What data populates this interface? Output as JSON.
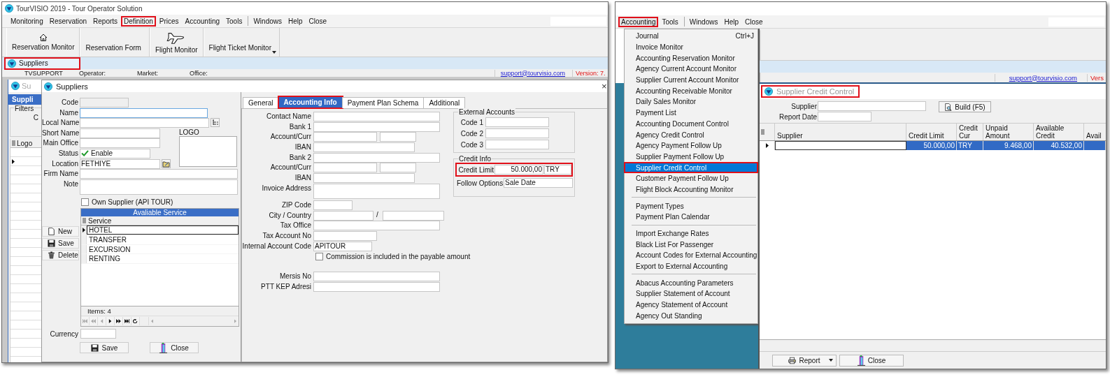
{
  "left_screen": {
    "title": "TourVISIO 2019 - Tour Operator Solution",
    "menu": [
      [
        {
          "label": "Monitoring",
          "highlighted": false
        },
        {
          "label": "Reservation",
          "highlighted": false
        },
        {
          "label": "Reports",
          "highlighted": false
        },
        {
          "label": "Definition",
          "highlighted": true
        },
        {
          "label": "Prices",
          "highlighted": false
        },
        {
          "label": "Accounting",
          "highlighted": false
        },
        {
          "label": "Tools",
          "highlighted": false
        }
      ],
      [
        {
          "label": "Windows",
          "highlighted": false
        },
        {
          "label": "Help",
          "highlighted": false
        },
        {
          "label": "Close",
          "highlighted": false
        }
      ]
    ],
    "toolbar": [
      {
        "label": "Reservation Monitor",
        "kind": "house",
        "dropdown": false
      },
      {
        "label": "Reservation Form",
        "kind": "plain",
        "dropdown": false
      },
      {
        "label": "Flight Monitor",
        "kind": "plane",
        "dropdown": false
      },
      {
        "label": "Flight Ticket Monitor",
        "kind": "plain",
        "dropdown": true
      }
    ],
    "open_tabs": [
      {
        "label": "Suppliers",
        "selected": true,
        "highlighted": true
      }
    ],
    "status_bar": {
      "user": "TVSUPPORT",
      "operator": "Operator:",
      "market": "Market:",
      "office": "Office:",
      "email": "support@tourvisio.com",
      "version": "Version: 7."
    },
    "background_window": {
      "title": "Su",
      "header": "Suppli",
      "filters": "Filters",
      "filter_label": "C",
      "column": "Logo"
    },
    "dialog": {
      "title": "Suppliers",
      "close": "×",
      "fields": [
        {
          "label": "Code",
          "kind": "code",
          "focused": false
        },
        {
          "label": "Name",
          "kind": "name",
          "focused": true
        },
        {
          "label": "Local Name",
          "kind": "lookup",
          "focused": false
        },
        {
          "label": "Short Name",
          "kind": "short",
          "focused": false
        },
        {
          "label": "Main Office",
          "kind": "short",
          "focused": false
        },
        {
          "label": "Status",
          "kind": "status",
          "value": "Enable",
          "focused": false
        },
        {
          "label": "Location",
          "kind": "location",
          "value": "FETHIYE",
          "focused": false
        },
        {
          "label": "Firm Name",
          "kind": "wide",
          "focused": false
        },
        {
          "label": "Note",
          "kind": "note",
          "focused": false
        }
      ],
      "logo_label": "LOGO",
      "own_supplier": {
        "label": "Own Supplier (API TOUR)",
        "checked": false
      },
      "side_buttons": [
        {
          "label": "New",
          "kind": "new"
        },
        {
          "label": "Save",
          "kind": "save"
        },
        {
          "label": "Delete",
          "kind": "delete"
        }
      ],
      "services": {
        "title": "Avaliable Service",
        "column": "Service",
        "rows": [
          {
            "name": "HOTEL",
            "selected": true
          },
          {
            "name": "TRANSFER",
            "selected": false
          },
          {
            "name": "EXCURSION",
            "selected": false
          },
          {
            "name": "RENTING",
            "selected": false
          }
        ],
        "footer": "Items: 4"
      },
      "currency_label": "Currency",
      "buttons": [
        {
          "label": "Save",
          "kind": "save"
        },
        {
          "label": "Close",
          "kind": "close"
        }
      ],
      "tabs": [
        {
          "label": "General",
          "selected": false,
          "highlighted": false
        },
        {
          "label": "Accounting Info",
          "selected": true,
          "highlighted": true
        },
        {
          "label": "Payment Plan Schema",
          "selected": false,
          "highlighted": false
        },
        {
          "label": "Additional",
          "selected": false,
          "highlighted": false
        }
      ],
      "accounting_fields": [
        {
          "label": "Contact Name",
          "kind": "wide"
        },
        {
          "label": "Bank 1",
          "kind": "wide"
        },
        {
          "label": "Account/Curr",
          "kind": "pair"
        },
        {
          "label": "IBAN",
          "kind": "medium"
        },
        {
          "label": "Bank 2",
          "kind": "wide"
        },
        {
          "label": "Account/Curr",
          "kind": "pair"
        },
        {
          "label": "IBAN",
          "kind": "medium"
        },
        {
          "label": "Invoice Address",
          "kind": "address"
        },
        {
          "label": "ZIP Code",
          "kind": "zip"
        },
        {
          "label": "City / Country",
          "kind": "city",
          "separator": "/"
        },
        {
          "label": "Tax Office",
          "kind": "wide"
        },
        {
          "label": "Tax Account No",
          "kind": "account_no"
        },
        {
          "label": "Internal Account Code",
          "kind": "code",
          "value": "APITOUR"
        },
        {
          "label": "Commission is included in the payable amount",
          "kind": "checkbox",
          "checked": false
        }
      ],
      "registry_fields": [
        {
          "label": "Mersis No"
        },
        {
          "label": "PTT KEP Adresi"
        }
      ],
      "external_accounts": {
        "title": "External Accounts",
        "codes": [
          "Code 1",
          "Code 2",
          "Code 3"
        ]
      },
      "credit_info": {
        "title": "Credit Info",
        "credit_limit_label": "Credit Limit",
        "credit_limit": "50.000,00",
        "currency": "TRY",
        "highlighted": true,
        "follow_label": "Follow Options",
        "follow_value": "Sale Date"
      }
    }
  },
  "right_screen": {
    "menu": [
      [
        {
          "label": "Accounting",
          "highlighted": true
        },
        {
          "label": "Tools",
          "highlighted": false
        }
      ],
      [
        {
          "label": "Windows",
          "highlighted": false
        },
        {
          "label": "Help",
          "highlighted": false
        },
        {
          "label": "Close",
          "highlighted": false
        }
      ]
    ],
    "dropdown": [
      [
        {
          "label": "Journal",
          "shortcut": "Ctrl+J",
          "selected": false
        },
        {
          "label": "Invoice Monitor",
          "selected": false
        },
        {
          "label": "Accounting Reservation Monitor",
          "selected": false
        },
        {
          "label": "Agency Current Account Monitor",
          "selected": false
        },
        {
          "label": "Supplier Current Account Monitor",
          "selected": false
        },
        {
          "label": "Accounting Receivable Monitor",
          "selected": false
        },
        {
          "label": "Daily Sales Monitor",
          "selected": false
        },
        {
          "label": "Payment List",
          "selected": false
        },
        {
          "label": "Accounting Document Control",
          "selected": false
        },
        {
          "label": "Agency Credit Control",
          "selected": false
        },
        {
          "label": "Agency Payment Follow Up",
          "selected": false
        },
        {
          "label": "Supplier Payment Follow Up",
          "selected": false
        },
        {
          "label": "Supplier Credit Control",
          "selected": true
        },
        {
          "label": "Customer Payment Follow Up",
          "selected": false
        },
        {
          "label": "Flight Block Accounting Monitor",
          "selected": false
        }
      ],
      [
        {
          "label": "Payment Types",
          "selected": false
        },
        {
          "label": "Payment Plan Calendar",
          "selected": false
        }
      ],
      [
        {
          "label": "Import Exchange Rates",
          "selected": false
        },
        {
          "label": "Black List For Passenger",
          "selected": false
        },
        {
          "label": "Account Codes for External Accounting",
          "selected": false
        },
        {
          "label": "Export to External Accounting",
          "selected": false
        }
      ],
      [
        {
          "label": "Abacus Accounting Parameters",
          "selected": false
        },
        {
          "label": "Supplier Statement of Account",
          "selected": false
        },
        {
          "label": "Agency Statement of Account",
          "selected": false
        },
        {
          "label": "Agency Out Standing",
          "selected": false
        }
      ]
    ],
    "status_bar": {
      "email": "support@tourvisio.com",
      "version": "Vers"
    },
    "report_window": {
      "title": "Supplier Credit Control",
      "highlighted": true,
      "supplier_label": "Supplier",
      "report_date_label": "Report Date",
      "build_button": "Build (F5)",
      "columns": [
        "Supplier",
        "Credit Limit",
        "Credit Cur",
        "Unpaid Amount",
        "Available Credit",
        "Avail"
      ],
      "rows": [
        {
          "credit_limit": "50.000,00",
          "credit_cur": "TRY",
          "unpaid_amount": "9.468,00",
          "available_credit": "40.532,00",
          "selected": true
        }
      ],
      "buttons": [
        {
          "label": "Report",
          "kind": "report",
          "dropdown": true
        },
        {
          "label": "Close",
          "kind": "close",
          "dropdown": false
        }
      ]
    }
  }
}
